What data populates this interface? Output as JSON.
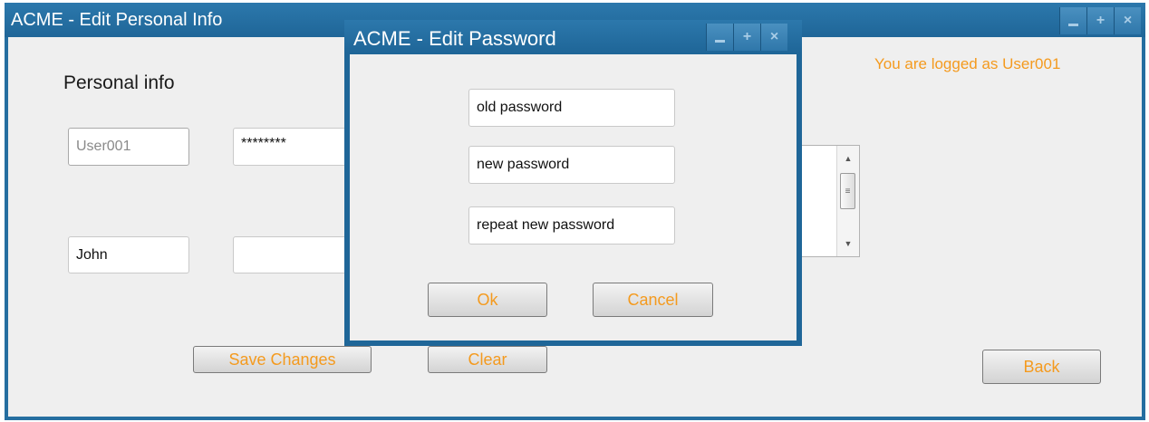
{
  "main_window": {
    "title": "ACME - Edit Personal Info",
    "logged_in_text": "You are logged as User001",
    "section_heading": "Personal info",
    "fields": {
      "username_value": "User001",
      "password_value": "********",
      "first_name_value": "John",
      "last_name_value": ""
    },
    "buttons": {
      "save_label": "Save Changes",
      "clear_label": "Clear",
      "back_label": "Back"
    },
    "scrollbar": {
      "up_glyph": "▲",
      "down_glyph": "▼",
      "thumb_glyph": "≡"
    }
  },
  "dialog": {
    "title": "ACME - Edit Password",
    "fields": {
      "old_password_placeholder": "old password",
      "new_password_placeholder": "new password",
      "repeat_password_placeholder": "repeat new password"
    },
    "buttons": {
      "ok_label": "Ok",
      "cancel_label": "Cancel"
    }
  },
  "window_controls": {
    "maximize_glyph": "+",
    "close_glyph": "×"
  },
  "colors": {
    "title_bar": "#256ea0",
    "accent_text": "#f49a1e",
    "client_bg": "#efefef"
  }
}
